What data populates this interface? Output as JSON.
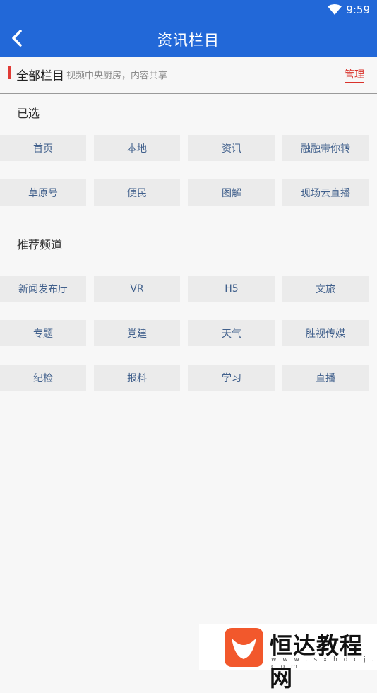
{
  "status": {
    "time": "9:59",
    "wifi_icon": "wifi-icon"
  },
  "appbar": {
    "title": "资讯栏目",
    "back_icon": "back-arrow-icon"
  },
  "header": {
    "title": "全部栏目",
    "subtitle": "视频中央厨房，内容共享",
    "manage_label": "管理",
    "accent": "#e03b36"
  },
  "selected": {
    "label": "已选",
    "items": [
      "首页",
      "本地",
      "资讯",
      "融融带你转",
      "草原号",
      "便民",
      "图解",
      "现场云直播"
    ]
  },
  "recommended": {
    "label": "推荐频道",
    "items": [
      "新闻发布厅",
      "VR",
      "H5",
      "文旅",
      "专题",
      "党建",
      "天气",
      "胜视传媒",
      "纪检",
      "报料",
      "学习",
      "直播"
    ]
  },
  "watermark": {
    "brand": "恒达教程网",
    "url": "w w w . s x h d c j . c o m"
  },
  "colors": {
    "primary": "#2268d8",
    "chip_bg": "#ebebeb",
    "chip_text": "#41608c"
  }
}
